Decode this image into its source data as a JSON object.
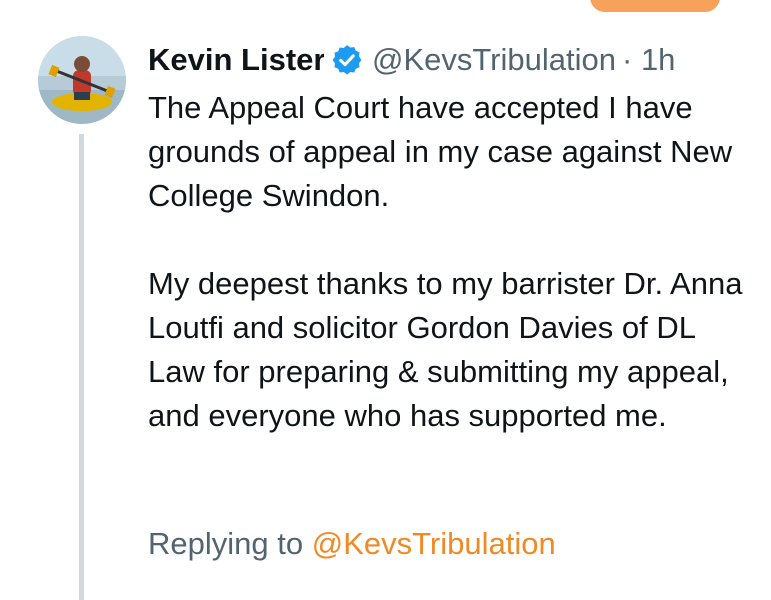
{
  "tweet": {
    "display_name": "Kevin Lister",
    "handle": "@KevsTribulation",
    "separator": "·",
    "timestamp": "1h",
    "paragraphs": [
      "The Appeal Court have accepted I have grounds of appeal in my case against New College Swindon.",
      "My deepest thanks to my barrister Dr. Anna Loutfi and solicitor Gordon Davies of DL Law for preparing & submitting my appeal, and everyone who has supported me."
    ],
    "replying_prefix": "Replying to",
    "replying_to": "@KevsTribulation",
    "verified_icon": "verified-badge-icon",
    "avatar": "kayaker-photo"
  },
  "colors": {
    "accent": "#f08a24",
    "verified": "#1d9bf0",
    "muted_text": "#536471",
    "thread_line": "#cfd9de"
  }
}
